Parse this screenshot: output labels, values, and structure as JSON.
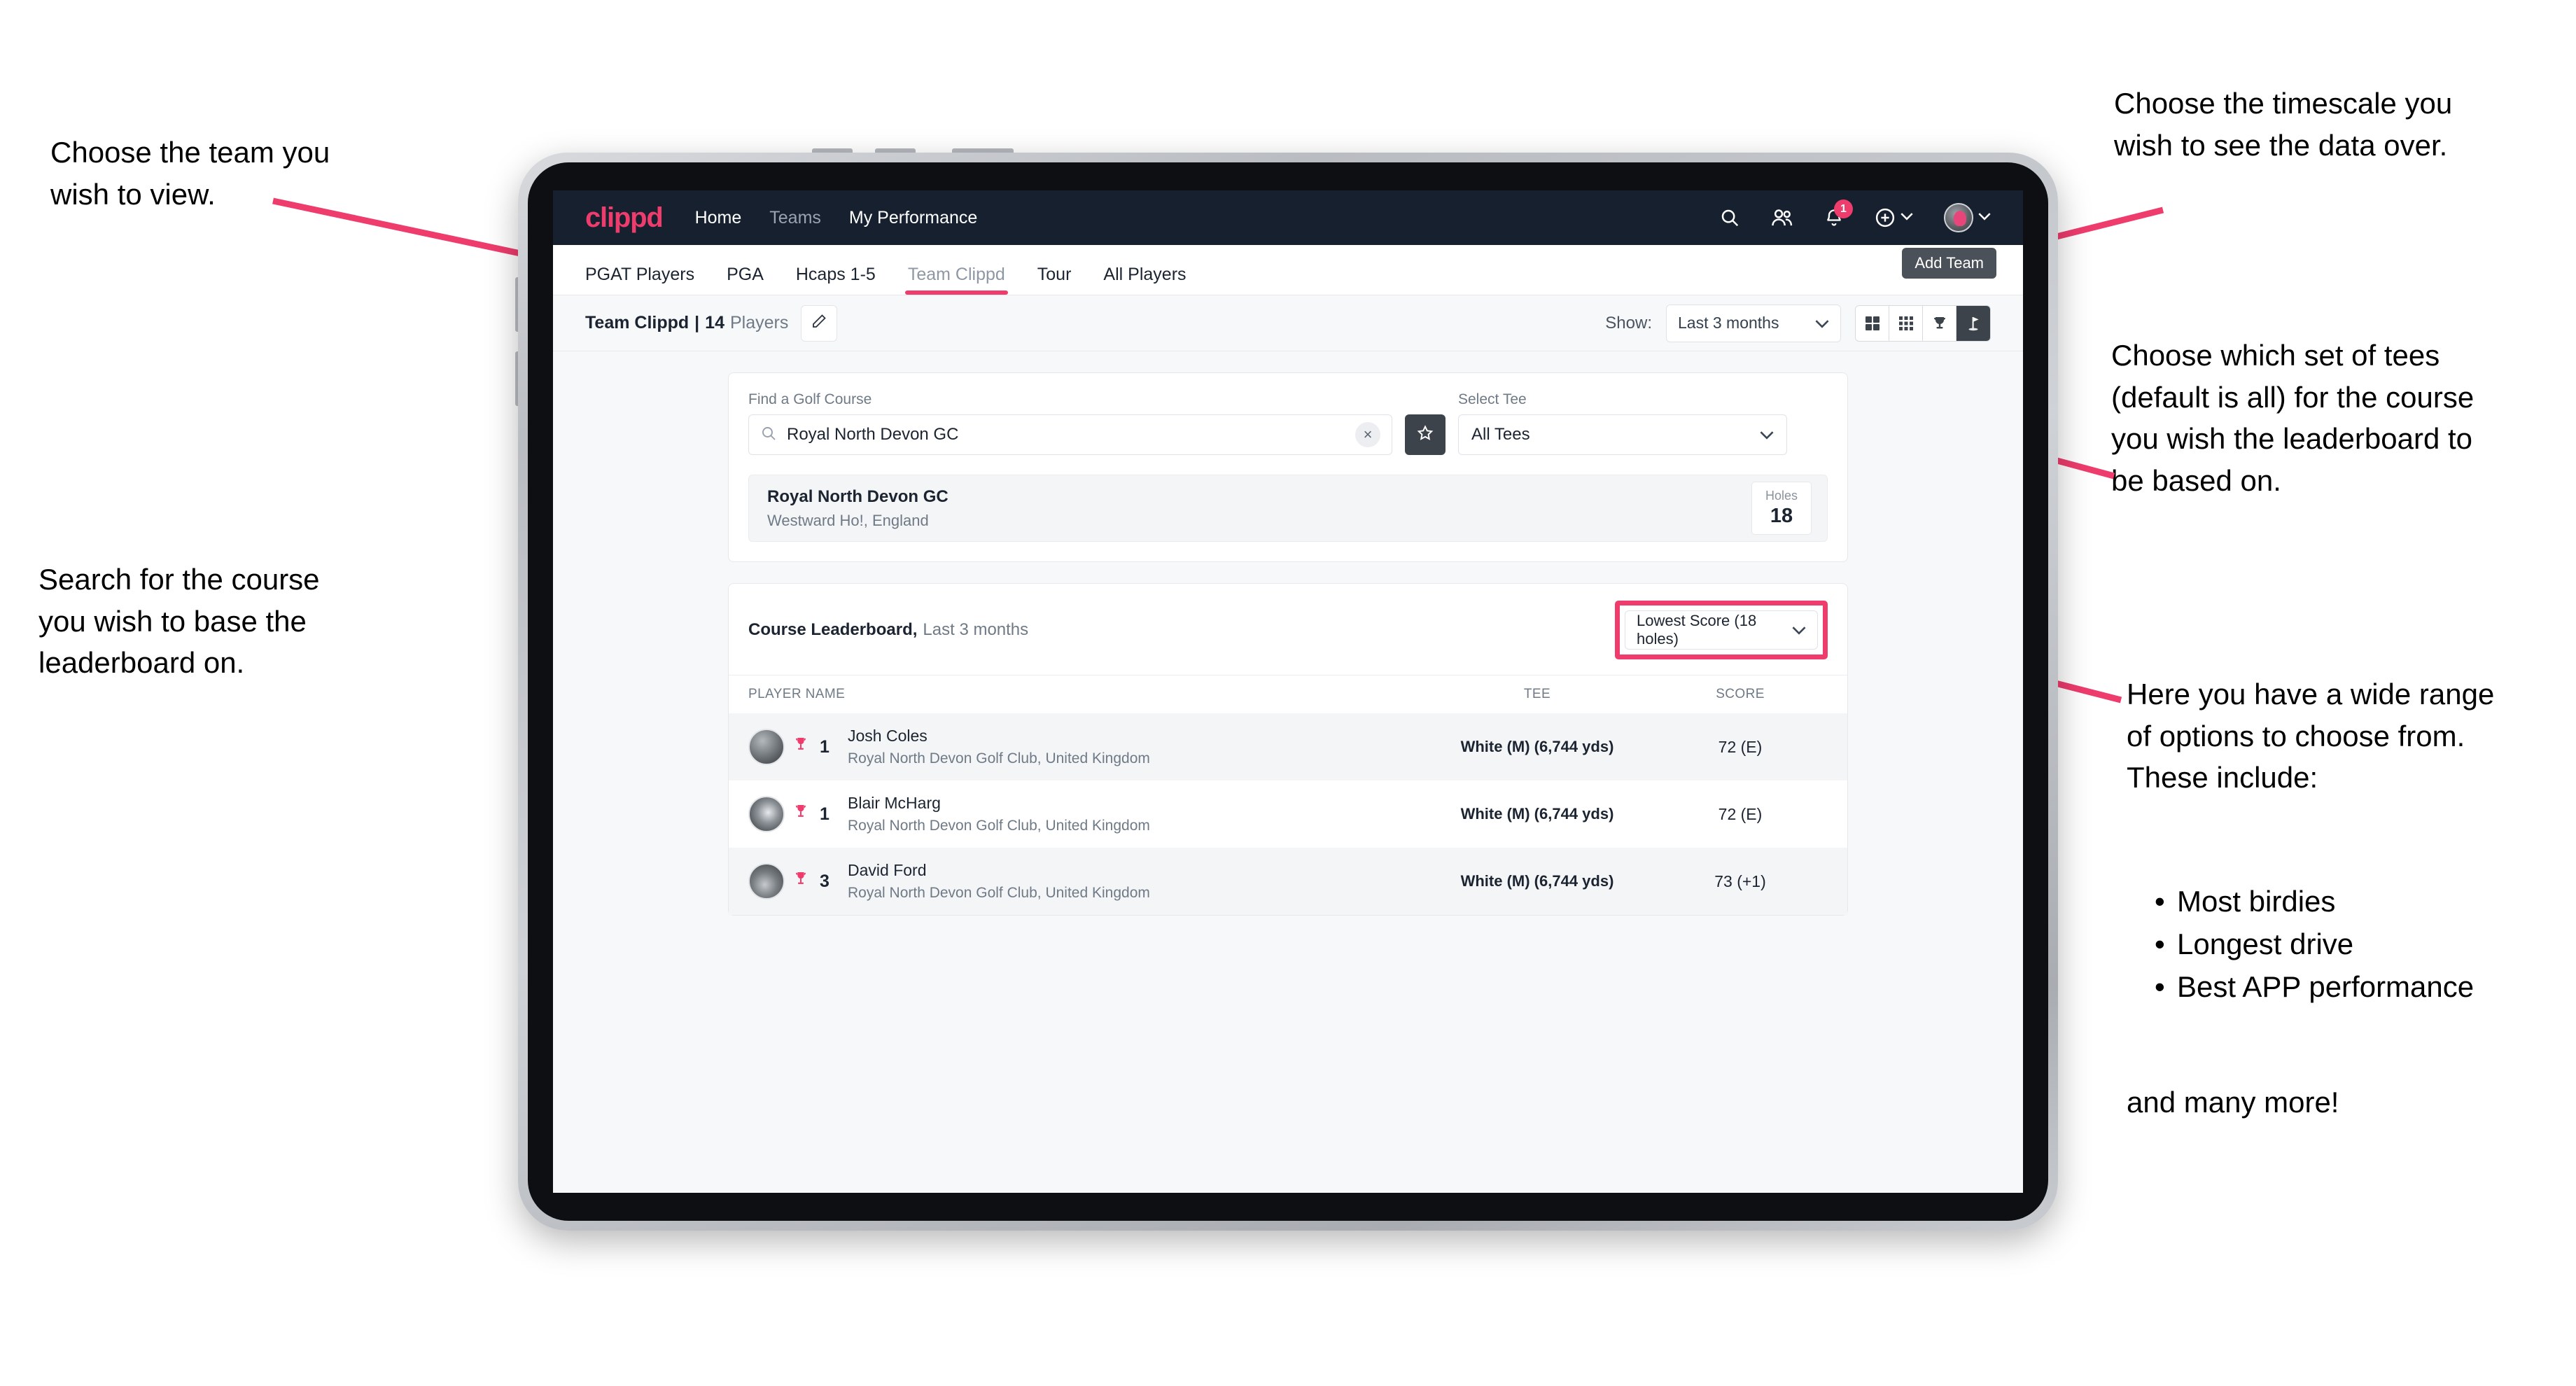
{
  "annotations": {
    "team": "Choose the team you\nwish to view.",
    "timescale": "Choose the timescale you\nwish to see the data over.",
    "tees": "Choose which set of tees\n(default is all) for the course\nyou wish the leaderboard to\nbe based on.",
    "search": "Search for the course\nyou wish to base the\nleaderboard on.",
    "options_intro": "Here you have a wide range\nof options to choose from.\nThese include:",
    "options_list": [
      "Most birdies",
      "Longest drive",
      "Best APP performance"
    ],
    "options_outro": "and many more!"
  },
  "navbar": {
    "logo": "clippd",
    "links": [
      {
        "label": "Home",
        "active": true
      },
      {
        "label": "Teams",
        "active": false
      },
      {
        "label": "My Performance",
        "active": true
      }
    ],
    "icons": [
      "search-icon",
      "people-icon",
      "bell-icon",
      "plus-icon",
      "avatar"
    ],
    "notification_count": "1"
  },
  "tabs": [
    {
      "label": "PGAT Players",
      "state": "normal"
    },
    {
      "label": "PGA",
      "state": "normal"
    },
    {
      "label": "Hcaps 1-5",
      "state": "normal"
    },
    {
      "label": "Team Clippd",
      "state": "active"
    },
    {
      "label": "Tour",
      "state": "normal"
    },
    {
      "label": "All Players",
      "state": "normal"
    }
  ],
  "tooltip": {
    "label": "Add Team"
  },
  "toolbar": {
    "team_name": "Team Clippd",
    "separator": "|",
    "player_count": "14",
    "players_word": "Players",
    "edit_icon": "pencil-icon",
    "show_label": "Show:",
    "timescale_value": "Last 3 months",
    "view_buttons": [
      {
        "name": "grid-2x2-view",
        "active": false
      },
      {
        "name": "grid-3x3-view",
        "active": false
      },
      {
        "name": "trophy-view",
        "active": false
      },
      {
        "name": "course-view",
        "active": true
      }
    ]
  },
  "search_panel": {
    "course_label": "Find a Golf Course",
    "course_value": "Royal North Devon GC",
    "course_placeholder": "Find a Golf Course",
    "clear_label": "×",
    "favourite_icon": "star-icon",
    "tee_label": "Select Tee",
    "tee_value": "All Tees"
  },
  "course_result": {
    "name": "Royal North Devon GC",
    "location": "Westward Ho!, England",
    "holes_label": "Holes",
    "holes_value": "18"
  },
  "leaderboard": {
    "title": "Course Leaderboard,",
    "subtitle": "Last 3 months",
    "sort_value": "Lowest Score (18 holes)",
    "columns": {
      "name": "PLAYER NAME",
      "tee": "TEE",
      "score": "SCORE"
    },
    "rows": [
      {
        "rank": "1",
        "name": "Josh Coles",
        "club": "Royal North Devon Golf Club, United Kingdom",
        "tee": "White (M) (6,744 yds)",
        "score": "72 (E)"
      },
      {
        "rank": "1",
        "name": "Blair McHarg",
        "club": "Royal North Devon Golf Club, United Kingdom",
        "tee": "White (M) (6,744 yds)",
        "score": "72 (E)"
      },
      {
        "rank": "3",
        "name": "David Ford",
        "club": "Royal North Devon Golf Club, United Kingdom",
        "tee": "White (M) (6,744 yds)",
        "score": "73 (+1)"
      }
    ]
  },
  "colors": {
    "accent_pink": "#ee3c6d",
    "navbar_dark": "#16202e",
    "page_bg": "#f7f8fa",
    "dark_button": "#3c434b"
  }
}
